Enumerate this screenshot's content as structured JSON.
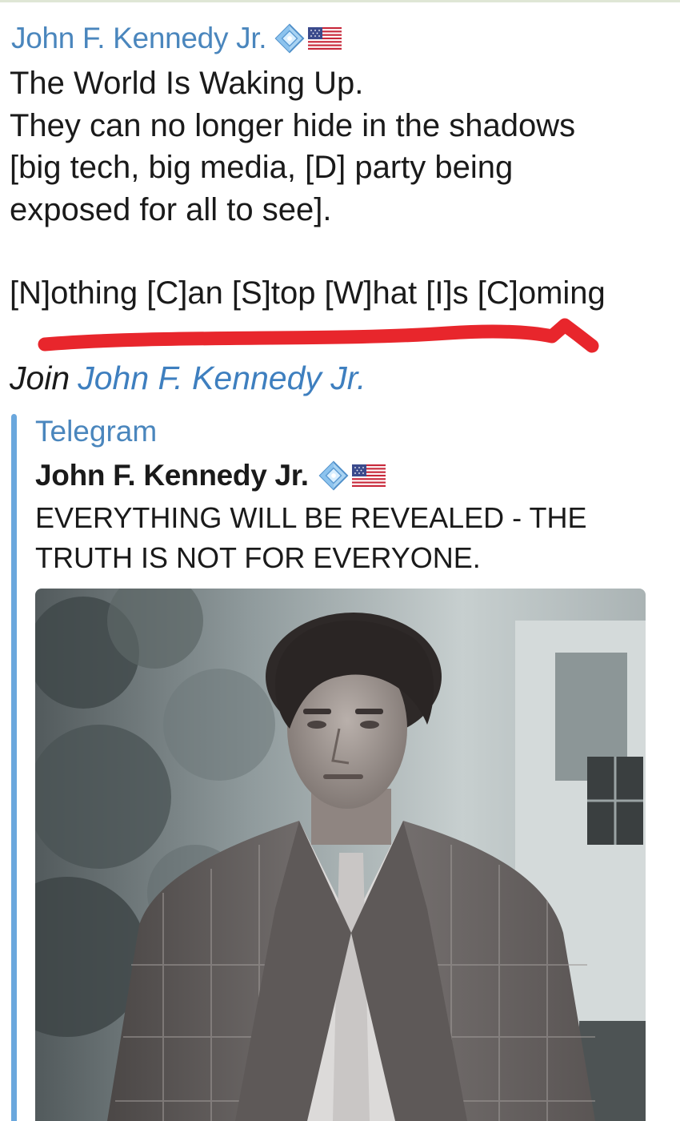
{
  "message": {
    "sender": "John F. Kennedy Jr.",
    "badge_icon": "blue-diamond-icon",
    "flag_icon": "us-flag-icon",
    "lines": [
      "The World Is Waking Up.",
      "They can no longer hide in the shadows",
      "[big tech, big media, [D] party being",
      "exposed for all to see]."
    ],
    "highlight_line": "[N]othing [C]an [S]top [W]hat [I]s [C]oming",
    "underline_color": "#e8262c",
    "join_prefix": "Join",
    "join_link": "John F. Kennedy Jr."
  },
  "link_preview": {
    "site": "Telegram",
    "title": "John F. Kennedy Jr.",
    "description": "EVERYTHING WILL BE REVEALED - THE TRUTH IS NOT FOR EVERYONE.",
    "accent_color": "#6aa7dd"
  },
  "colors": {
    "link": "#4a86bd",
    "text": "#1a1a1a"
  }
}
